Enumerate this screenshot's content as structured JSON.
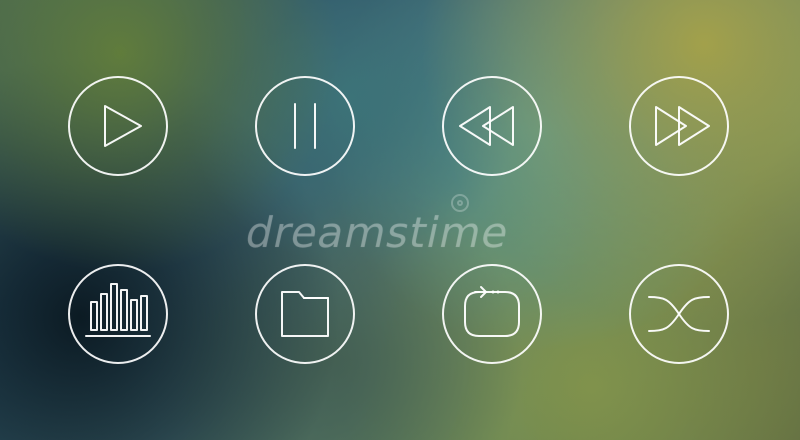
{
  "watermark": {
    "text": "dreamstime"
  },
  "icons": [
    {
      "name": "play-icon"
    },
    {
      "name": "pause-icon"
    },
    {
      "name": "rewind-icon"
    },
    {
      "name": "fast-forward-icon"
    },
    {
      "name": "equalizer-icon"
    },
    {
      "name": "folder-icon"
    },
    {
      "name": "repeat-icon"
    },
    {
      "name": "shuffle-icon"
    }
  ]
}
